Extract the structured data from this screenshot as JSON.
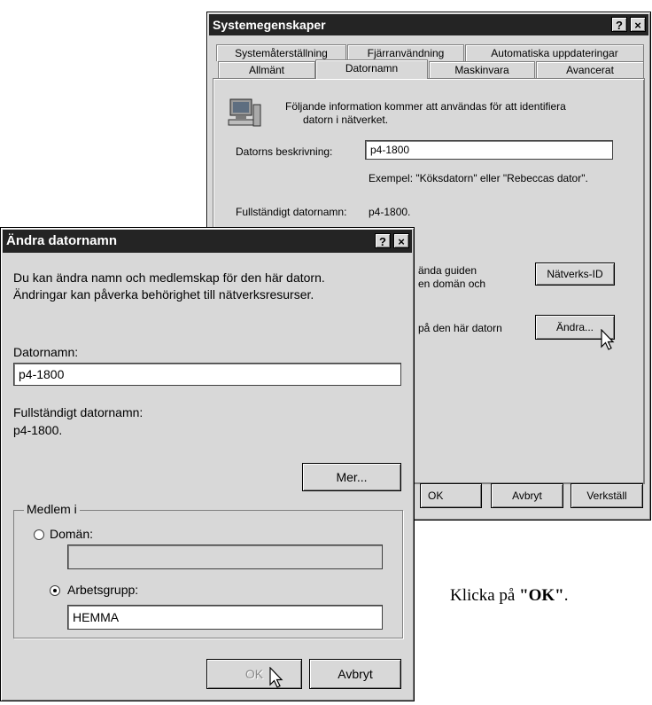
{
  "back_window": {
    "title": "Systemegenskaper",
    "help_btn": "?",
    "close_btn": "×",
    "tabs_row1": [
      "Systemåterställning",
      "Fjärranvändning",
      "Automatiska uppdateringar"
    ],
    "tabs_row2": [
      "Allmänt",
      "Datornamn",
      "Maskinvara",
      "Avancerat"
    ],
    "active_tab": "Datornamn",
    "info_text_1": "Följande information kommer att användas för att identifiera",
    "info_text_2": "datorn i nätverket.",
    "description_label": "Datorns beskrivning:",
    "description_value": "p4-1800",
    "example_text": "Exempel: \"Köksdatorn\" eller \"Rebeccas dator\".",
    "fullname_label": "Fullständigt datornamn:",
    "fullname_value": "p4-1800.",
    "partial_text_1a": "ända guiden",
    "partial_text_1b": "en domän och",
    "partial_text_2": "på den här datorn",
    "network_id_button": "Nätverks-ID",
    "change_button": "Ändra...",
    "ok_button": "OK",
    "cancel_button": "Avbryt",
    "apply_button": "Verkställ"
  },
  "front_dialog": {
    "title": "Ändra datornamn",
    "help_btn": "?",
    "close_btn": "×",
    "intro_line1": "Du kan ändra namn och medlemskap för den här datorn.",
    "intro_line2": "Ändringar kan påverka behörighet till nätverksresurser.",
    "name_label": "Datornamn:",
    "name_value": "p4-1800",
    "fullname_label": "Fullständigt datornamn:",
    "fullname_value": "p4-1800.",
    "more_button": "Mer...",
    "member_group_label": "Medlem i",
    "domain_label": "Domän:",
    "domain_value": "",
    "domain_selected": false,
    "workgroup_label": "Arbetsgrupp:",
    "workgroup_value": "HEMMA",
    "workgroup_selected": true,
    "ok_button": "OK",
    "cancel_button": "Avbryt"
  },
  "caption": {
    "prefix": "Klicka på ",
    "emphasis": "\"OK\"",
    "suffix": "."
  }
}
